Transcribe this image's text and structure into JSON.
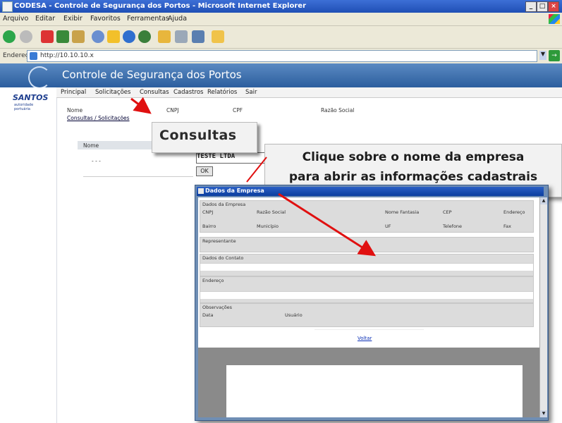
{
  "window": {
    "title": "CODESA - Controle de Segurança dos Portos - Microsoft Internet Explorer",
    "buttons": [
      "_",
      "□",
      "×"
    ]
  },
  "menu": [
    "Arquivo",
    "Editar",
    "Exibir",
    "Favoritos",
    "Ferramentas",
    "Ajuda"
  ],
  "address": {
    "label": "Endereço",
    "url": "http://10.10.10.x"
  },
  "site": {
    "title": "Controle de Segurança dos Portos",
    "logo_text": "SANTOS",
    "logo_sub": "autoridade portuária"
  },
  "nav": [
    "Principal",
    "Solicitações",
    "Consultas",
    "Cadastros",
    "Relatórios",
    "Sair"
  ],
  "page": {
    "consultas_link": "Consultas / Solicitações",
    "col_labels": [
      "Nome",
      "CNPJ",
      "CPF",
      "Razão Social"
    ],
    "table_header": "Nome",
    "table_value": "- - -",
    "company_value": "TESTE LTDA",
    "ok_button": "OK"
  },
  "callouts": {
    "consultas": "Consultas",
    "tip_line1": "Clique sobre o nome da empresa",
    "tip_line2": "para abrir as informações cadastrais"
  },
  "popup": {
    "title": "Dados da Empresa",
    "sections": [
      "Dados da Empresa",
      "Representante",
      "Dados do Contato",
      "Endereço",
      "Observações"
    ],
    "fields_row1": [
      "CNPJ",
      "Razão Social",
      "Nome Fantasia",
      "CEP",
      "Endereço"
    ],
    "fields_row2": [
      "Bairro",
      "Município",
      "UF",
      "Telefone",
      "Fax"
    ],
    "fields_obs": [
      "Data",
      "Usuário"
    ],
    "link_text": "Voltar"
  },
  "colors": {
    "header_blue": "#2c5e9e",
    "titlebar_blue": "#1f4fb5",
    "arrow_red": "#e01010"
  },
  "icons": [
    "back-icon",
    "forward-icon",
    "stop-icon",
    "refresh-icon",
    "home-icon",
    "search-icon",
    "favorites-icon",
    "media-icon",
    "history-icon",
    "mail-icon",
    "print-icon",
    "edit-icon",
    "folder-icon"
  ]
}
